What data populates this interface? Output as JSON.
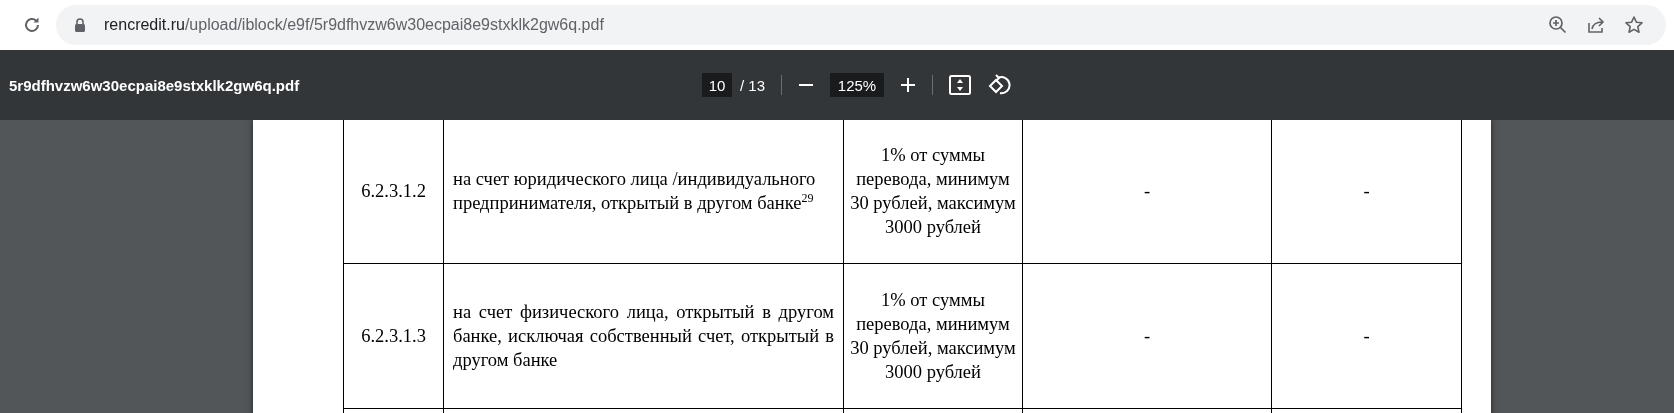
{
  "address_bar": {
    "host": "rencredit.ru",
    "path": "/upload/iblock/e9f/5r9dfhvzw6w30ecpai8e9stxklk2gw6q.pdf"
  },
  "pdf_toolbar": {
    "title": "5r9dfhvzw6w30ecpai8e9stxklk2gw6q.pdf",
    "page": "10",
    "page_total": "/ 13",
    "zoom": "125%"
  },
  "table": {
    "rows": [
      {
        "number": "6.2.3.1.2",
        "description": "на счет юридического лица /индивидуального предпринимателя, открытый в другом банке$^{29}$",
        "justified": false,
        "fee": "1% от суммы перевода, минимум 30 рублей, максимум 3000 рублей",
        "column_4": "-",
        "column_5": "-"
      },
      {
        "number": "6.2.3.1.3",
        "description": "на счет физического лица, открытый в другом банке, исключая собственный счет, открытый в другом банке",
        "justified": true,
        "fee": "1% от суммы перевода, минимум 30 рублей, максимум 3000 рублей",
        "column_4": "-",
        "column_5": "-"
      }
    ]
  }
}
